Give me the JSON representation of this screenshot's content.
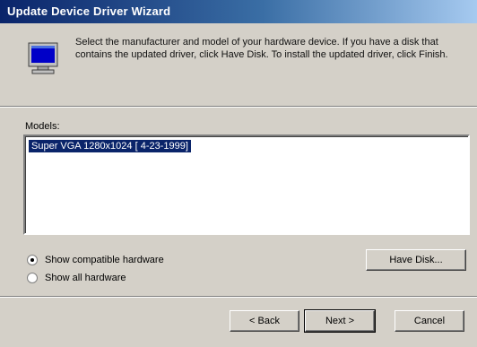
{
  "window": {
    "title": "Update Device Driver Wizard"
  },
  "header": {
    "instructions": "Select the manufacturer and model of your hardware device. If you have a disk that contains the updated driver, click Have Disk. To install the updated driver, click Finish.",
    "icon": "monitor-icon"
  },
  "models": {
    "label": "Models:",
    "items": [
      "Super VGA 1280x1024 [ 4-23-1999]"
    ],
    "selected_index": 0
  },
  "options": {
    "show_compatible_label": "Show compatible hardware",
    "show_all_label": "Show all hardware",
    "selected": "show_compatible"
  },
  "buttons": {
    "have_disk": "Have Disk...",
    "back": "< Back",
    "next": "Next >",
    "cancel": "Cancel"
  },
  "colors": {
    "face": "#d4d0c8",
    "title_start": "#0a246a",
    "title_end": "#a6caf0",
    "selection": "#0a246a"
  }
}
